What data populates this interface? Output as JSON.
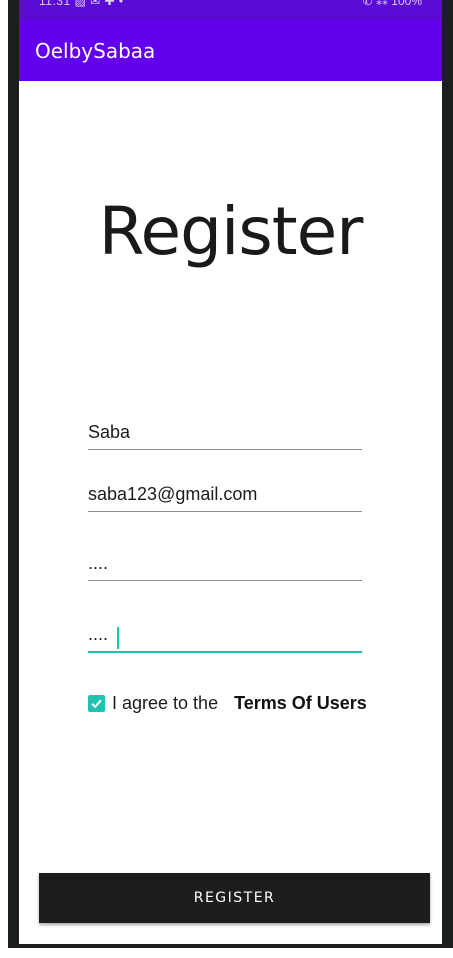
{
  "status_bar": {
    "time": "11:31",
    "notification_glyphs": "▨ ✉ ✚ •",
    "right_glyphs": "✆ ⁂ 100%"
  },
  "app_bar": {
    "title": "OelbySabaa"
  },
  "form": {
    "heading": "Register",
    "name_value": "Saba",
    "email_value": "saba123@gmail.com",
    "password_value": "....",
    "confirm_password_value": "....",
    "agree_checked": true,
    "agree_text": "I agree to the",
    "terms_link": "Terms Of Users",
    "register_label": "REGISTER"
  },
  "colors": {
    "app_bar": "#6200ee",
    "status_bar": "#5b0bd6",
    "accent": "#1fc1b1",
    "button": "#1d1d1d"
  }
}
